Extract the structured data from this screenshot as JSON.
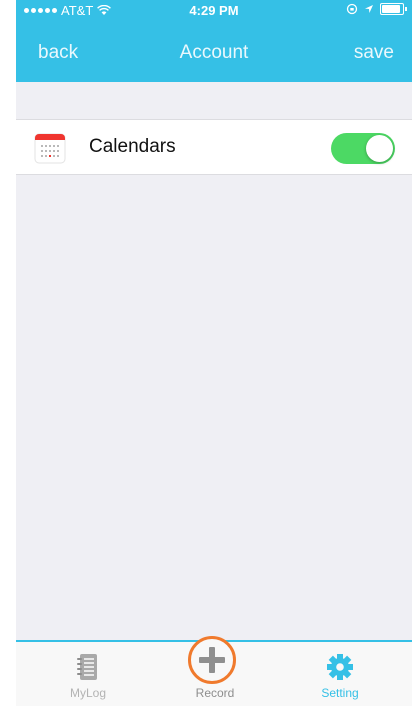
{
  "status_bar": {
    "carrier": "AT&T",
    "time": "4:29 PM"
  },
  "nav": {
    "back_label": "back",
    "title": "Account",
    "save_label": "save"
  },
  "settings": {
    "calendars_label": "Calendars",
    "calendars_enabled": true
  },
  "tabs": [
    {
      "label": "MyLog",
      "icon": "notebook-icon",
      "active": false
    },
    {
      "label": "Record",
      "icon": "plus-icon",
      "active": false
    },
    {
      "label": "Setting",
      "icon": "gear-icon",
      "active": true
    }
  ],
  "colors": {
    "header": "#35c0e6",
    "toggle_on": "#4cd964",
    "record_ring": "#f07a2d",
    "active_tab": "#35c0e6",
    "inactive_tab": "#9a9a9a"
  }
}
